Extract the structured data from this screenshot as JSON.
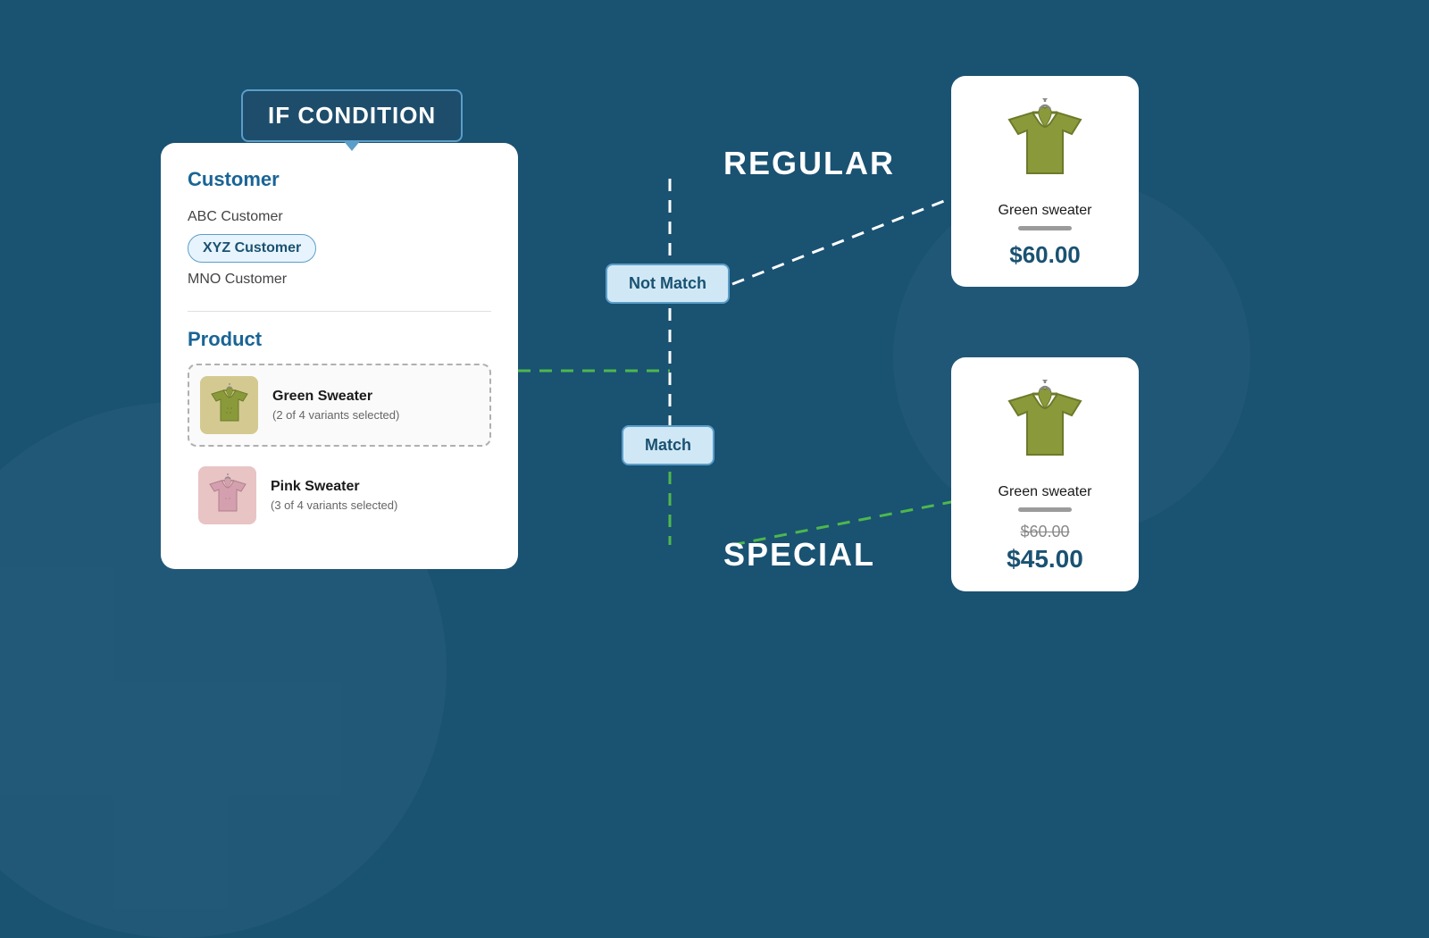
{
  "badge": {
    "label": "IF CONDITION"
  },
  "conditionCard": {
    "customerSection": {
      "title": "Customer",
      "items": [
        {
          "label": "ABC Customer",
          "selected": false
        },
        {
          "label": "XYZ Customer",
          "selected": true
        },
        {
          "label": "MNO Customer",
          "selected": false
        }
      ]
    },
    "productSection": {
      "title": "Product",
      "items": [
        {
          "name": "Green Sweater",
          "variants": "(2 of 4 variants selected)",
          "color": "green",
          "selected": true
        },
        {
          "name": "Pink Sweater",
          "variants": "(3 of 4 variants selected)",
          "color": "pink",
          "selected": false
        }
      ]
    }
  },
  "flow": {
    "notMatchLabel": "Not Match",
    "matchLabel": "Match",
    "regularLabel": "REGULAR",
    "specialLabel": "SPECIAL"
  },
  "productCards": {
    "regular": {
      "name": "Green sweater",
      "price": "$60.00"
    },
    "special": {
      "name": "Green sweater",
      "originalPrice": "$60.00",
      "specialPrice": "$45.00"
    }
  }
}
